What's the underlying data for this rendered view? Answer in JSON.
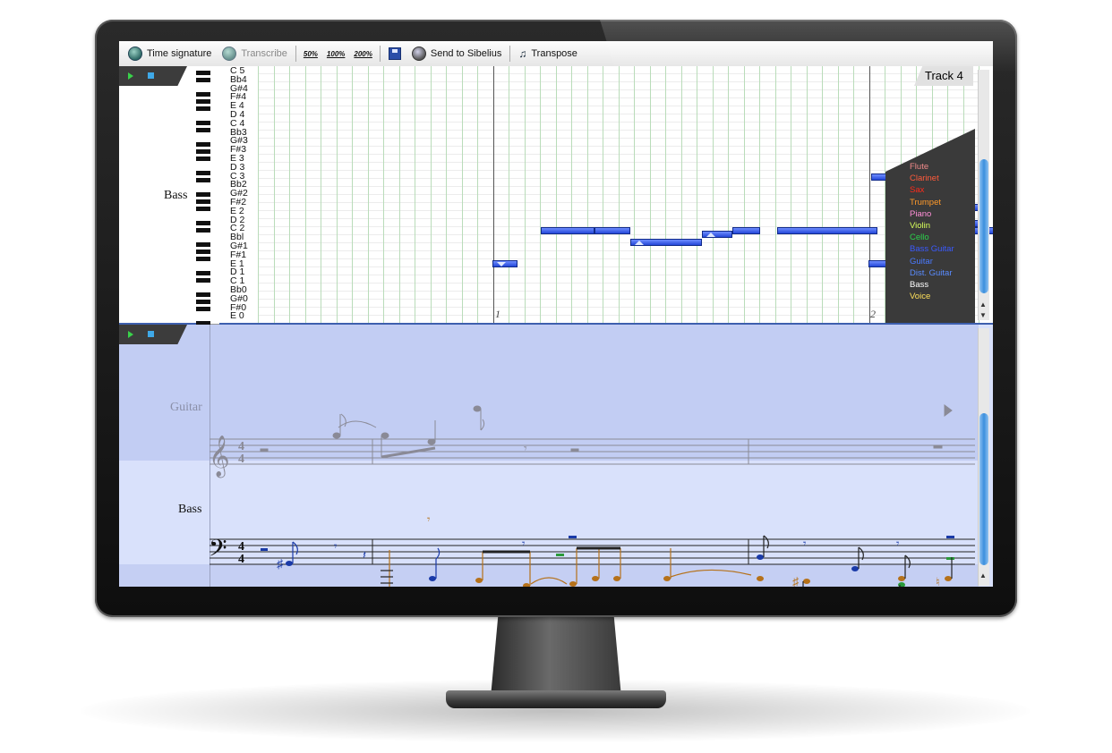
{
  "toolbar": {
    "time_signature": "Time signature",
    "transcribe": "Transcribe",
    "zoom_50": "50%",
    "zoom_100": "100%",
    "zoom_200": "200%",
    "send_to_sibelius": "Send to Sibelius",
    "transpose": "Transpose"
  },
  "piano_roll": {
    "track_label": "Bass",
    "track_tab": "Track 4",
    "note_names": [
      "C 5",
      "Bb4",
      "G#4",
      "F#4",
      "E 4",
      "D 4",
      "C 4",
      "Bb3",
      "G#3",
      "F#3",
      "E 3",
      "D 3",
      "C 3",
      "Bb2",
      "G#2",
      "F#2",
      "E 2",
      "D 2",
      "C 2",
      "Bbl",
      "G#1",
      "F#1",
      "E 1",
      "D 1",
      "C 1",
      "Bb0",
      "G#0",
      "F#0",
      "E 0"
    ],
    "bar_numbers": [
      "1",
      "2"
    ],
    "instruments": [
      {
        "name": "Flute",
        "color": "#f08a8a"
      },
      {
        "name": "Clarinet",
        "color": "#ff5a3a"
      },
      {
        "name": "Sax",
        "color": "#ff2a1a"
      },
      {
        "name": "Trumpet",
        "color": "#ff9a2a"
      },
      {
        "name": "Piano",
        "color": "#ff8fd8"
      },
      {
        "name": "Violin",
        "color": "#d8ff5a"
      },
      {
        "name": "Cello",
        "color": "#2ad24a"
      },
      {
        "name": "Bass Guitar",
        "color": "#3a5aff"
      },
      {
        "name": "Guitar",
        "color": "#4a7aff"
      },
      {
        "name": "Dist. Guitar",
        "color": "#5a8cff"
      },
      {
        "name": "Bass",
        "color": "#ffffff"
      },
      {
        "name": "Voice",
        "color": "#ffe05a"
      }
    ]
  },
  "score": {
    "guitar_label": "Guitar",
    "bass_label": "Bass",
    "time_sig_top": "4",
    "time_sig_bottom": "4"
  },
  "colors": {
    "accent_blue": "#2447d8",
    "score_band": "#c2cdf3"
  }
}
